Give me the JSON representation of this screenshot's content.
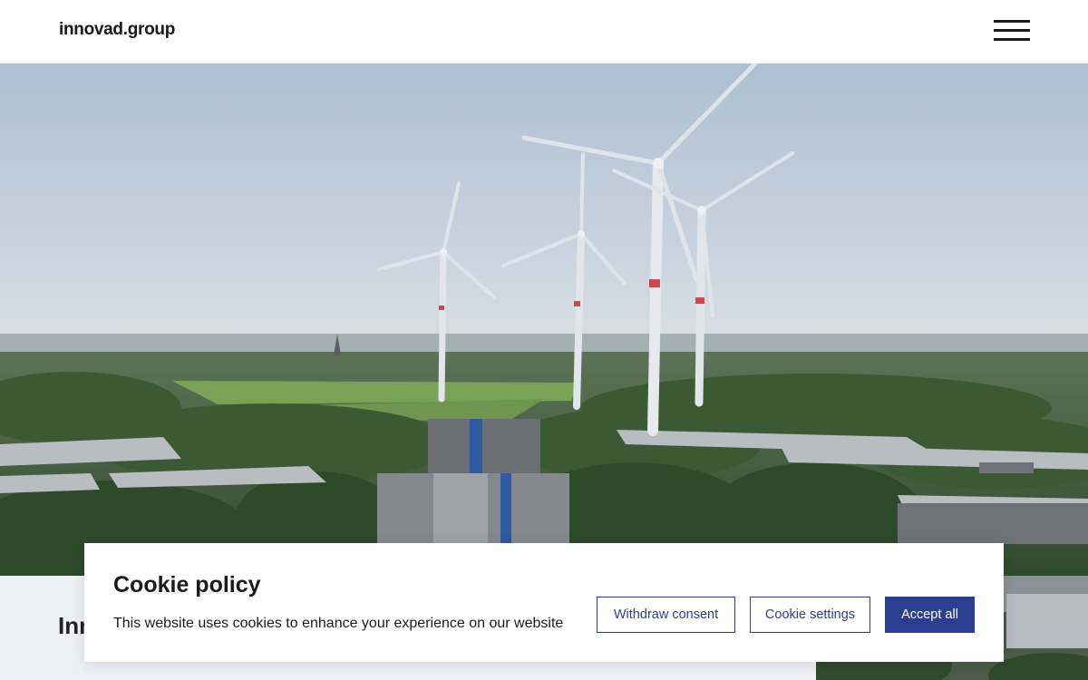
{
  "header": {
    "logo_text": "innovad.group",
    "menu_icon": "hamburger-menu-icon"
  },
  "hero": {
    "image_subject": "wind-turbines-over-industrial-landscape"
  },
  "below": {
    "title_partial": "Inn"
  },
  "cookie": {
    "title": "Cookie policy",
    "text": "This website uses cookies to enhance your experience on our website",
    "withdraw_label": "Withdraw consent",
    "settings_label": "Cookie settings",
    "accept_label": "Accept all"
  },
  "colors": {
    "accent": "#2c3e8f",
    "panel_bg": "#eef0f6",
    "sky_top": "#b5c6d8",
    "sky_bottom": "#d9e0e6"
  }
}
